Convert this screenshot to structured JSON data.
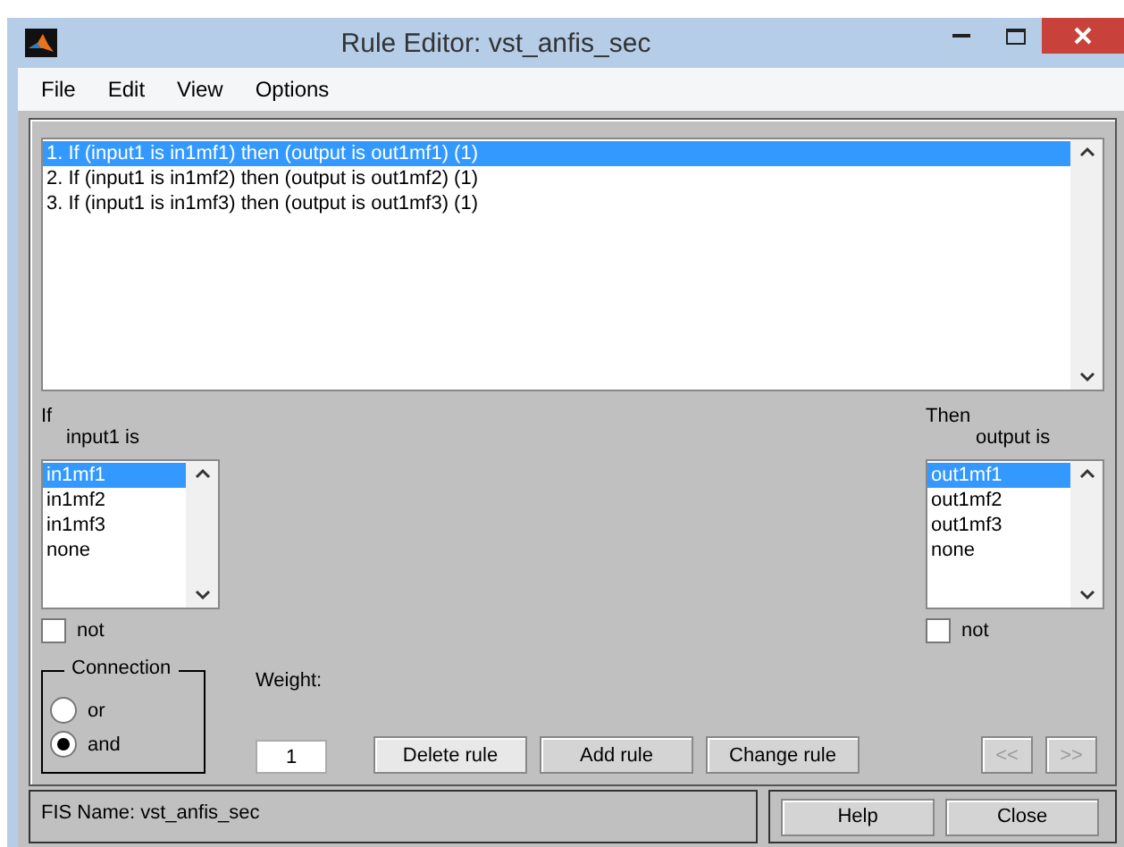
{
  "window": {
    "title": "Rule Editor: vst_anfis_sec"
  },
  "menu": [
    "File",
    "Edit",
    "View",
    "Options"
  ],
  "rules": [
    {
      "text": "1. If (input1 is in1mf1) then (output is out1mf1) (1)",
      "selected": true
    },
    {
      "text": "2. If (input1 is in1mf2) then (output is out1mf2) (1)",
      "selected": false
    },
    {
      "text": "3. If (input1 is in1mf3) then (output is out1mf3) (1)",
      "selected": false
    }
  ],
  "antecedent": {
    "heading": "If",
    "variable": "input1 is",
    "options": [
      {
        "label": "in1mf1",
        "selected": true
      },
      {
        "label": "in1mf2",
        "selected": false
      },
      {
        "label": "in1mf3",
        "selected": false
      },
      {
        "label": "none",
        "selected": false
      }
    ],
    "not": {
      "label": "not",
      "checked": false
    }
  },
  "consequent": {
    "heading": "Then",
    "variable": "output is",
    "options": [
      {
        "label": "out1mf1",
        "selected": true
      },
      {
        "label": "out1mf2",
        "selected": false
      },
      {
        "label": "out1mf3",
        "selected": false
      },
      {
        "label": "none",
        "selected": false
      }
    ],
    "not": {
      "label": "not",
      "checked": false
    }
  },
  "connection": {
    "title": "Connection",
    "options": [
      {
        "label": "or",
        "selected": false
      },
      {
        "label": "and",
        "selected": true
      }
    ]
  },
  "weight": {
    "label": "Weight:",
    "value": "1"
  },
  "rule_buttons": [
    {
      "label": "Delete rule",
      "disabled": false
    },
    {
      "label": "Add rule",
      "disabled": false
    },
    {
      "label": "Change rule",
      "disabled": false
    }
  ],
  "nav_buttons": [
    {
      "label": "<<",
      "disabled": true
    },
    {
      "label": ">>",
      "disabled": true
    }
  ],
  "status": "FIS Name: vst_anfis_sec",
  "footer_buttons": [
    "Help",
    "Close"
  ]
}
